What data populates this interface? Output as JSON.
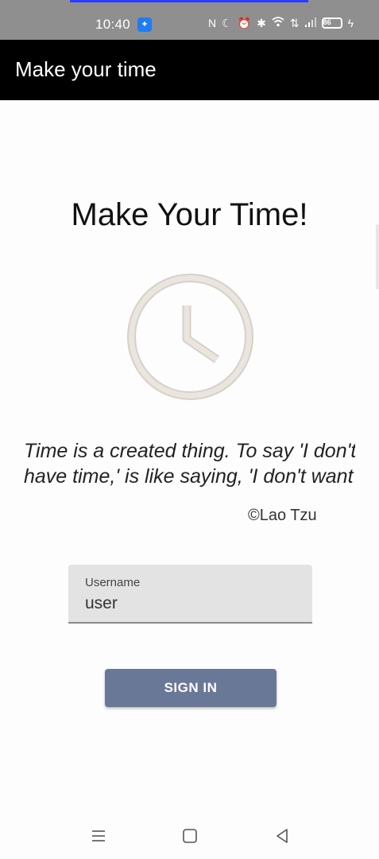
{
  "status_bar": {
    "time": "10:40",
    "app_icon": "✦",
    "icons": [
      "nfc-icon",
      "moon-icon",
      "alarm-icon",
      "bluetooth-icon",
      "wifi-icon",
      "data-icon",
      "signal-icon"
    ],
    "battery_level": "86",
    "accent_color": "#1f7cf2"
  },
  "app_bar": {
    "title": "Make your time",
    "background": "#000000"
  },
  "main": {
    "headline": "Make Your Time!",
    "clock_icon": "clock-icon",
    "quote_line_1": "Time is a created thing. To say 'I don't",
    "quote_line_2": "have time,' is like saying, 'I don't want to",
    "quote_author": "©Lao Tzu"
  },
  "login": {
    "username_label": "Username",
    "username_value": "user",
    "sign_in_label": "SIGN IN",
    "button_color": "#6a7898"
  },
  "nav_bar": {
    "buttons": [
      "menu-icon",
      "home-icon",
      "back-icon"
    ]
  }
}
